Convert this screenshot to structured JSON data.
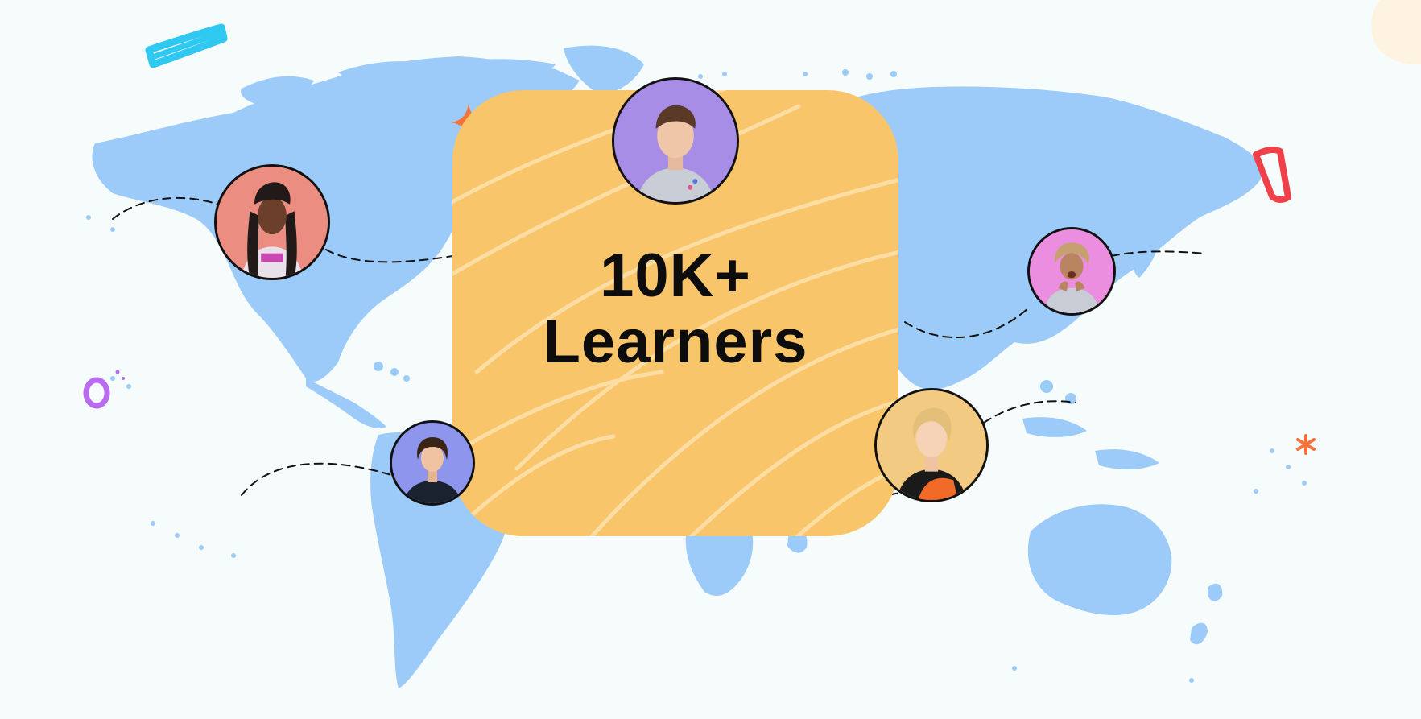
{
  "headline": {
    "line1": "10K+",
    "line2": "Learners"
  },
  "colors": {
    "background": "#f6fcfc",
    "map": "#9ccbf9",
    "card": "#f9c56b",
    "card_stroke": "#fde2ad",
    "text": "#0d0d0d",
    "avatar_purple": "#a88de6",
    "avatar_salmon": "#ec8d82",
    "avatar_pink": "#ec8ee0",
    "avatar_blue": "#8d95ec",
    "avatar_gold": "#f2ca82",
    "accent_orange": "#f5733a",
    "accent_cyan": "#2ec8f0",
    "accent_red": "#f0404a",
    "accent_violet": "#b96cf0"
  },
  "avatars": [
    {
      "id": "top-center",
      "bg": "#a88de6",
      "icon": "learner-avatar"
    },
    {
      "id": "left",
      "bg": "#ec8d82",
      "icon": "learner-avatar"
    },
    {
      "id": "right",
      "bg": "#ec8ee0",
      "icon": "learner-avatar"
    },
    {
      "id": "bottom-left",
      "bg": "#8d95ec",
      "icon": "learner-avatar"
    },
    {
      "id": "bottom-right",
      "bg": "#f2ca82",
      "icon": "learner-avatar"
    }
  ]
}
